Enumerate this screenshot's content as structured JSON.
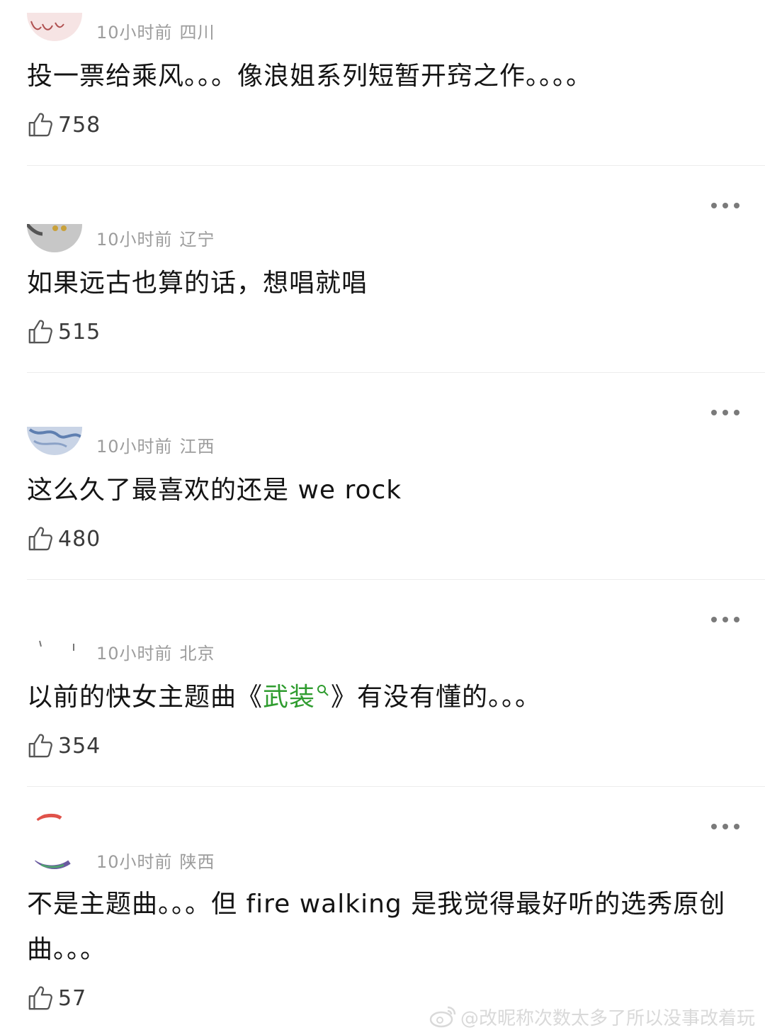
{
  "comments": [
    {
      "time": "10小时前",
      "location": "四川",
      "text_before": "投一票给乘风。。。像浪姐系列短暂开窍之作。。。。",
      "link_text": "",
      "text_after": "",
      "likes": "758"
    },
    {
      "time": "10小时前",
      "location": "辽宁",
      "text_before": "如果远古也算的话，想唱就唱",
      "link_text": "",
      "text_after": "",
      "likes": "515"
    },
    {
      "time": "10小时前",
      "location": "江西",
      "text_before": "这么久了最喜欢的还是 we rock",
      "link_text": "",
      "text_after": "",
      "likes": "480"
    },
    {
      "time": "10小时前",
      "location": "北京",
      "text_before": "以前的快女主题曲《",
      "link_text": "武装",
      "text_after": "》有没有懂的。。。",
      "likes": "354"
    },
    {
      "time": "10小时前",
      "location": "陕西",
      "text_before": "不是主题曲。。。但 fire walking 是我觉得最好听的选秀原创曲。。。",
      "link_text": "",
      "text_after": "",
      "likes": "57"
    }
  ],
  "watermark": {
    "text": "@改昵称次数太多了所以没事改着玩"
  },
  "colors": {
    "link": "#2f9c2f",
    "meta": "#9c9c9c",
    "divider": "#ececec"
  },
  "icons": {
    "like": "thumbs-up-icon",
    "more": "more-dots-icon",
    "search": "search-icon",
    "watermark": "weibo-logo-icon"
  }
}
